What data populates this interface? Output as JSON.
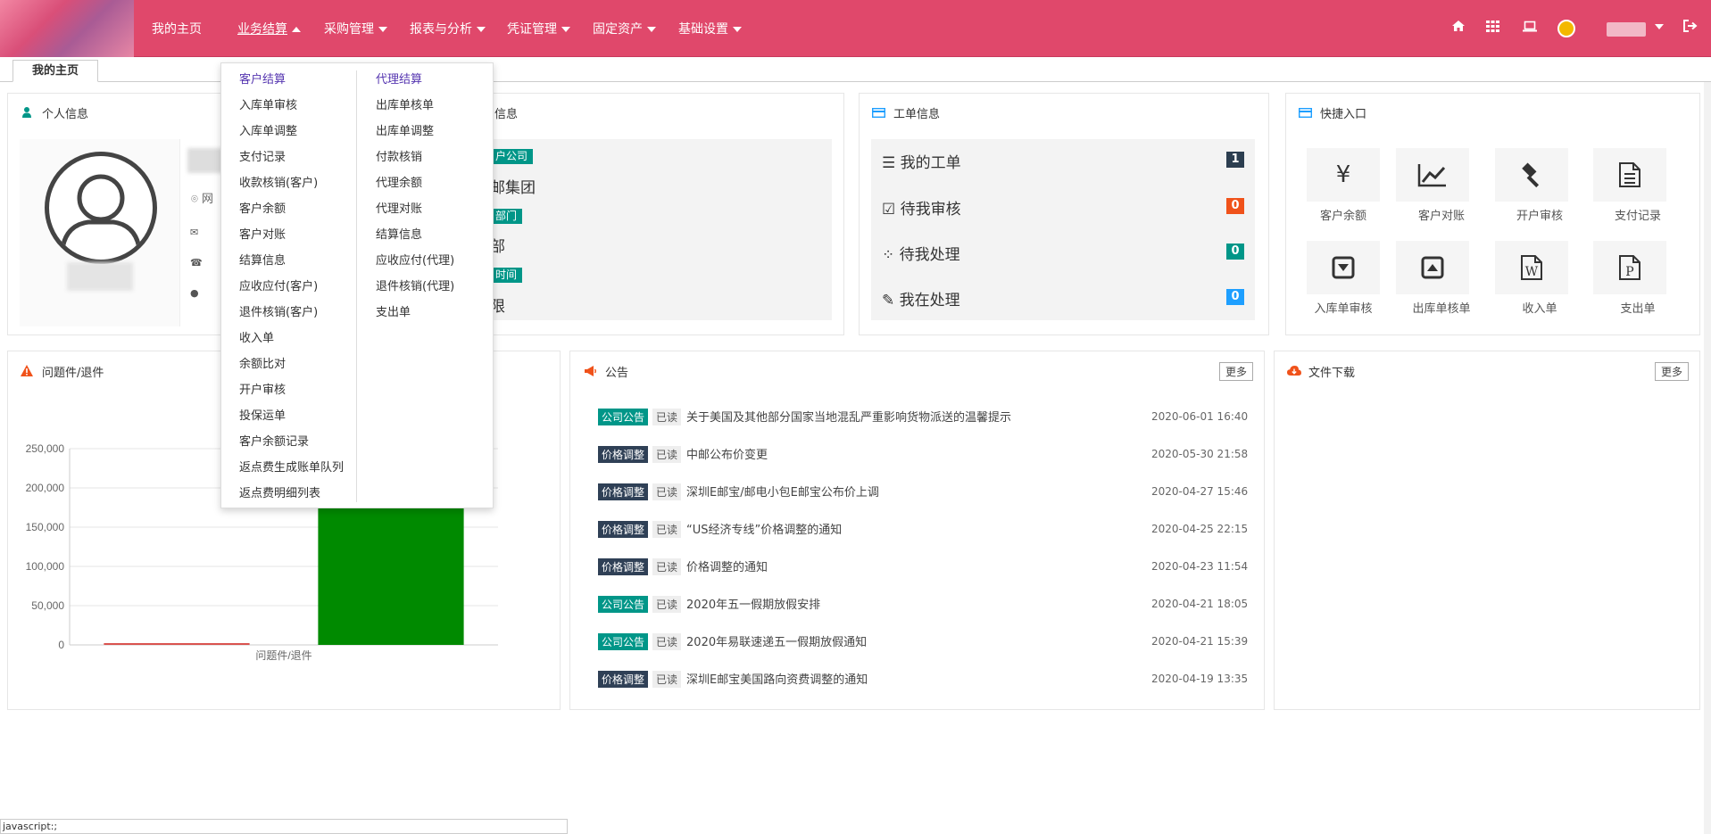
{
  "nav": {
    "home": "我的主页",
    "items": [
      "业务结算",
      "采购管理",
      "报表与分析",
      "凭证管理",
      "固定资产",
      "基础设置"
    ]
  },
  "tabs": [
    "我的主页"
  ],
  "dropdown": {
    "col1_head": "客户结算",
    "col1": [
      "入库单审核",
      "入库单调整",
      "支付记录",
      "收款核销(客户)",
      "客户余额",
      "客户对账",
      "结算信息",
      "应收应付(客户)",
      "退件核销(客户)",
      "收入单",
      "余额比对",
      "开户审核",
      "投保运单",
      "客户余额记录",
      "返点费生成账单队列",
      "返点费明细列表"
    ],
    "col2_head": "代理结算",
    "col2": [
      "出库单核单",
      "出库单调整",
      "付款核销",
      "代理余额",
      "代理对账",
      "结算信息",
      "应收应付(代理)",
      "退件核销(代理)",
      "支出单"
    ]
  },
  "personal": {
    "title": "个人信息",
    "row_web": "网"
  },
  "company": {
    "title": "信息",
    "tag1": "户公司",
    "val1": "邮集团",
    "tag2": "部门",
    "val2": "部",
    "tag3": "时间",
    "val3": "限"
  },
  "workorders": {
    "title": "工单信息",
    "rows": [
      {
        "label": "我的工单",
        "count": "1",
        "color": "#2c3e50"
      },
      {
        "label": "待我审核",
        "count": "0",
        "color": "#f0521a"
      },
      {
        "label": "待我处理",
        "count": "0",
        "color": "#009688"
      },
      {
        "label": "我在处理",
        "count": "0",
        "color": "#1e9fff"
      }
    ]
  },
  "quick": {
    "title": "快捷入口",
    "items": [
      {
        "label": "客户余额",
        "icon": "yen-icon",
        "glyph": "¥"
      },
      {
        "label": "客户对账",
        "icon": "chart-line-icon",
        "glyph": ""
      },
      {
        "label": "开户审核",
        "icon": "gavel-icon",
        "glyph": ""
      },
      {
        "label": "支付记录",
        "icon": "document-icon",
        "glyph": ""
      },
      {
        "label": "入库单审核",
        "icon": "caret-down-box-icon",
        "glyph": ""
      },
      {
        "label": "出库单核单",
        "icon": "caret-up-box-icon",
        "glyph": ""
      },
      {
        "label": "收入单",
        "icon": "word-doc-icon",
        "glyph": "W"
      },
      {
        "label": "支出单",
        "icon": "ppt-doc-icon",
        "glyph": "P"
      }
    ]
  },
  "problem": {
    "title": "问题件/退件"
  },
  "chart_data": {
    "type": "bar",
    "categories": [
      "",
      ""
    ],
    "series": [
      {
        "values": [
          1000,
          190000
        ]
      }
    ],
    "colors": [
      "#d9534f",
      "#008a00"
    ],
    "xlabel": "问题件/退件",
    "ylim": [
      0,
      250000
    ],
    "yticks": [
      "250,000",
      "200,000",
      "150,000",
      "100,000",
      "50,000",
      "0"
    ]
  },
  "notice": {
    "title": "公告",
    "more": "更多",
    "items": [
      {
        "tag": "公司公告",
        "tagColor": "#009688",
        "read": "已读",
        "title": "关于美国及其他部分国家当地混乱严重影响货物派送的温馨提示",
        "date": "2020-06-01 16:40"
      },
      {
        "tag": "价格调整",
        "tagColor": "#2f4056",
        "read": "已读",
        "title": "中邮公布价变更",
        "date": "2020-05-30 21:58"
      },
      {
        "tag": "价格调整",
        "tagColor": "#2f4056",
        "read": "已读",
        "title": "深圳E邮宝/邮电小包E邮宝公布价上调",
        "date": "2020-04-27 15:46"
      },
      {
        "tag": "价格调整",
        "tagColor": "#2f4056",
        "read": "已读",
        "title": "“US经济专线”价格调整的通知",
        "date": "2020-04-25 22:15"
      },
      {
        "tag": "价格调整",
        "tagColor": "#2f4056",
        "read": "已读",
        "title": "价格调整的通知",
        "date": "2020-04-23 11:54"
      },
      {
        "tag": "公司公告",
        "tagColor": "#009688",
        "read": "已读",
        "title": "2020年五一假期放假安排",
        "date": "2020-04-21 18:05"
      },
      {
        "tag": "公司公告",
        "tagColor": "#009688",
        "read": "已读",
        "title": "2020年易联速递五一假期放假通知",
        "date": "2020-04-21 15:39"
      },
      {
        "tag": "价格调整",
        "tagColor": "#2f4056",
        "read": "已读",
        "title": "深圳E邮宝美国路向资费调整的通知",
        "date": "2020-04-19 13:35"
      }
    ]
  },
  "files": {
    "title": "文件下载",
    "more": "更多"
  },
  "statusbar": "javascript:;"
}
